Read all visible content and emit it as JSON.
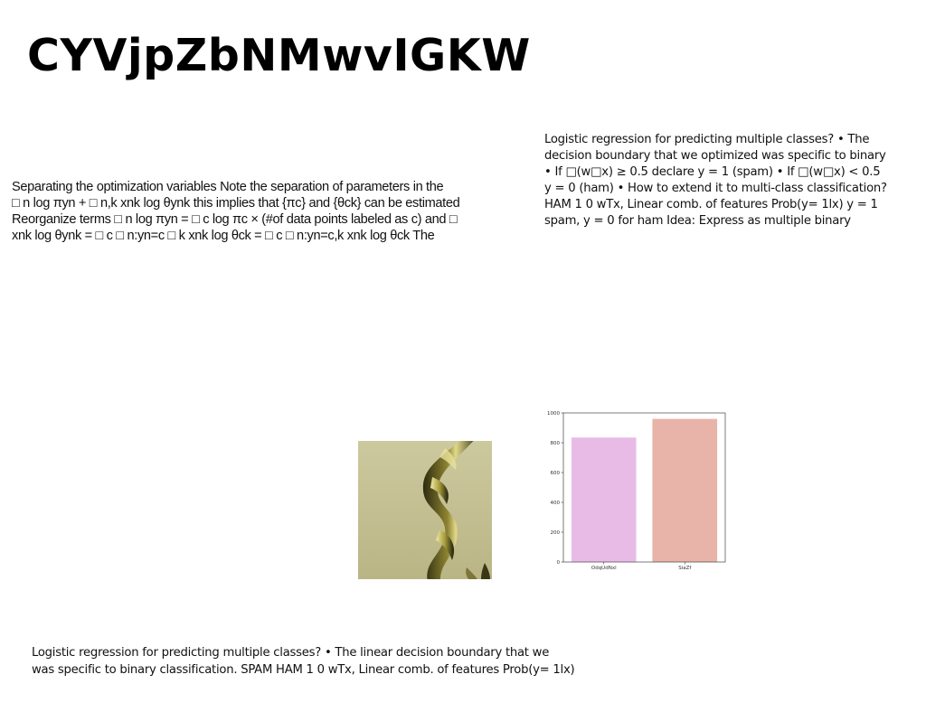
{
  "page": {
    "title": "CYVjpZbNMwvIGKW"
  },
  "text_blocks": {
    "left": "Separating the optimization variables Note the separation of parameters in the\n□ n log πyn + □ n,k xnk log θynk this implies that {πc} and {θck} can be estimated\nReorganize terms □ n log πyn = □ c log πc × (#of data points labeled as c) and □\nxnk log θynk = □ c □ n:yn=c □ k xnk log θck = □ c □ n:yn=c,k xnk log θck The",
    "right": "Logistic regression for predicting multiple classes? • The\ndecision boundary that we optimized was specific to binary\n• If □(w□x) ≥ 0.5 declare y = 1 (spam) • If □(w□x) < 0.5\ny = 0 (ham) • How to extend it to multi-class classification?\nHAM 1 0 wTx, Linear comb. of features Prob(y= 1lx) y = 1\nspam, y = 0 for ham Idea: Express as multiple binary",
    "bottom": "Logistic regression for predicting multiple classes? • The linear decision boundary that we\nwas specific to binary classification. SPAM HAM 1 0 wTx, Linear comb. of features Prob(y= 1lx)"
  },
  "image": {
    "icon": "twisted-gold-ribbon-photo",
    "background_color": "#c8c597"
  },
  "chart_data": {
    "type": "bar",
    "categories": [
      "OdqUdNxl",
      "SiaZf"
    ],
    "values": [
      835,
      960
    ],
    "colors": [
      "#e8bbe7",
      "#e8b3a8"
    ],
    "ylim": [
      0,
      1000
    ],
    "yticks": [
      0,
      200,
      400,
      600,
      800,
      1000
    ],
    "ytick_labels": [
      "0",
      "200",
      "400",
      "600",
      "800",
      "1000"
    ],
    "title": "",
    "xlabel": "",
    "ylabel": "",
    "grid": false
  }
}
